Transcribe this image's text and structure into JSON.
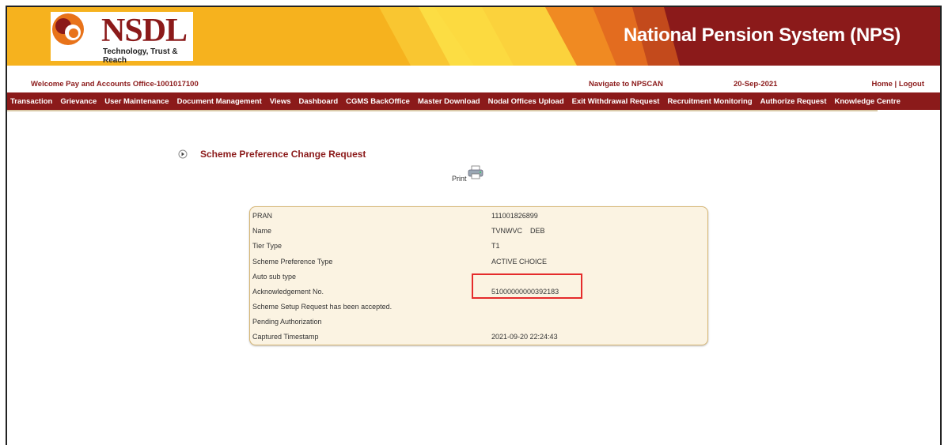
{
  "header": {
    "logo_text": "NSDL",
    "logo_tagline": "Technology, Trust & Reach",
    "system_title": "National Pension System (NPS)"
  },
  "infobar": {
    "welcome": "Welcome Pay and Accounts Office-1001017100",
    "navigate": "Navigate to NPSCAN",
    "date": "20-Sep-2021",
    "home_logout": "Home | Logout"
  },
  "menu": {
    "items": [
      "Transaction",
      "Grievance",
      "User Maintenance",
      "Document Management",
      "Views",
      "Dashboard",
      "CGMS BackOffice",
      "Master Download",
      "Nodal Offices Upload",
      "Exit Withdrawal Request",
      "Recruitment Monitoring",
      "Authorize Request",
      "Knowledge Centre"
    ]
  },
  "page": {
    "title": "Scheme Preference Change Request",
    "print_label": "Print"
  },
  "details": {
    "pran_label": "PRAN",
    "pran_value": "111001826899",
    "name_label": "Name",
    "name_value": "TVNWVC    DEB",
    "tier_label": "Tier Type",
    "tier_value": "T1",
    "scheme_pref_label": "Scheme Preference Type",
    "scheme_pref_value": "ACTIVE CHOICE",
    "auto_sub_label": "Auto sub type",
    "ack_label": "Acknowledgement No.",
    "ack_value": "51000000000392183",
    "accepted_msg": "Scheme Setup Request has been accepted.",
    "pending_msg": "Pending Authorization",
    "timestamp_label": "Captured Timestamp",
    "timestamp_value": "2021-09-20 22:24:43"
  },
  "colors": {
    "brand_maroon": "#8b1a1a",
    "banner_yellow": "#f7b11c",
    "panel_bg": "#fbf3e2",
    "highlight_red": "#e52b2b"
  }
}
